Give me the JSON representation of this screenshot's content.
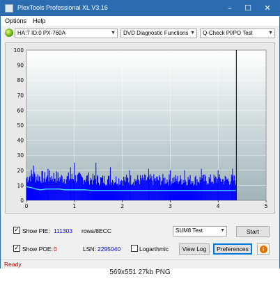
{
  "window": {
    "title": "PlexTools Professional XL V3.16",
    "minimize_glyph": "–",
    "maximize_glyph": "☐",
    "close_glyph": "✕"
  },
  "menu": {
    "items": [
      "Options",
      "Help"
    ]
  },
  "toolbar": {
    "drive": "HA:7 ID:0  PX-760A",
    "function": "DVD Diagnostic Functions",
    "test": "Q-Check PI/PO Test"
  },
  "chart_data": {
    "type": "bar",
    "x_ticks": [
      "0",
      "1",
      "2",
      "3",
      "4",
      "5"
    ],
    "y_ticks": [
      "0",
      "10",
      "20",
      "30",
      "40",
      "50",
      "60",
      "70",
      "80",
      "90",
      "100"
    ],
    "xlim": [
      0,
      5
    ],
    "ylim": [
      0,
      100
    ],
    "grid": true,
    "end_marker_x": 4.38,
    "series": [
      {
        "color": "#0000ff",
        "x": [
          0.0,
          0.1,
          0.2,
          0.3,
          0.4,
          0.5,
          0.6,
          0.7,
          0.8,
          0.9,
          1.0,
          1.1,
          1.2,
          1.3,
          1.4,
          1.5,
          1.6,
          1.7,
          1.8,
          1.9,
          2.0,
          2.1,
          2.2,
          2.3,
          2.4,
          2.5,
          2.6,
          2.7,
          2.8,
          2.9,
          3.0,
          3.1,
          3.2,
          3.3,
          3.4,
          3.5,
          3.6,
          3.7,
          3.8,
          3.9,
          4.0,
          4.1,
          4.2,
          4.3,
          4.38
        ],
        "values": [
          14,
          16,
          15,
          15,
          14,
          15,
          15,
          14,
          14,
          14,
          14,
          14,
          14,
          14,
          13,
          13,
          13,
          13,
          13,
          13,
          13,
          13,
          13,
          13,
          13,
          13,
          13,
          13,
          13,
          13,
          13,
          13,
          13,
          13,
          13,
          13,
          13,
          13,
          13,
          13,
          13,
          13,
          13,
          13,
          13
        ],
        "peaks": [
          [
            0.15,
            23
          ],
          [
            0.45,
            21
          ],
          [
            0.92,
            22
          ],
          [
            1.0,
            25
          ],
          [
            1.45,
            25
          ],
          [
            1.75,
            22
          ],
          [
            2.15,
            20
          ],
          [
            2.55,
            21
          ],
          [
            3.0,
            20
          ],
          [
            3.3,
            20
          ],
          [
            3.65,
            21
          ],
          [
            4.0,
            20
          ],
          [
            4.3,
            21
          ]
        ]
      },
      {
        "color": "#40e0ff",
        "x": [
          0.0,
          0.1,
          0.2,
          0.3,
          0.4,
          0.5,
          0.6,
          0.7,
          0.8,
          0.9,
          1.0,
          1.2,
          1.4,
          1.6,
          1.8,
          2.0,
          2.4,
          2.8,
          3.2,
          3.6,
          4.0,
          4.38
        ],
        "values": [
          9,
          8.5,
          7.5,
          7,
          7.5,
          7.5,
          7.5,
          7.5,
          7,
          7,
          7,
          7,
          6.5,
          6.5,
          6.5,
          6.5,
          6.5,
          6.5,
          6.5,
          6.5,
          6.5,
          6.5
        ]
      }
    ]
  },
  "controls": {
    "show_pie_label": "Show PIE:",
    "pie_value": "111303",
    "pie_unit": "rows/8ECC",
    "show_poe_label": "Show POE:",
    "poe_value": "0",
    "lsn_label": "LSN:",
    "lsn_value": "2295040",
    "logarithmic_label": "Logarthmic",
    "test_mode": "SUM8 Test",
    "start_label": "Start",
    "view_log_label": "View Log",
    "preferences_label": "Preferences",
    "info_glyph": "i",
    "check_glyph": "✓",
    "colors": {
      "pie_value": "#0000cc",
      "poe_value": "#cc0000",
      "lsn_value": "#0000cc"
    }
  },
  "status": {
    "text": "Ready",
    "color": "#cc0000"
  },
  "caption": "569x551 27kb PNG"
}
